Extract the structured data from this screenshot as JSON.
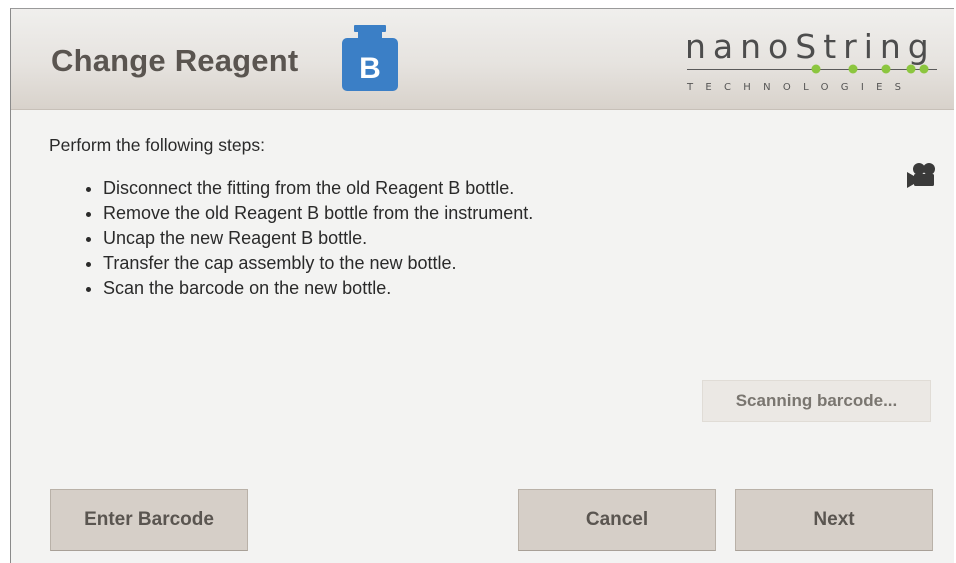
{
  "header": {
    "title": "Change Reagent",
    "bottle_letter": "B",
    "bottle_color": "#3b7fc6",
    "logo_word": "nanoString",
    "logo_sub": "TECHNOLOGIES",
    "logo_dot_color": "#8cc63f"
  },
  "instructions": {
    "intro": "Perform the following steps:",
    "steps": [
      "Disconnect the fitting from the old Reagent B bottle.",
      "Remove the old Reagent B bottle from the instrument.",
      "Uncap the new Reagent B bottle.",
      "Transfer the cap assembly to the new bottle.",
      "Scan the barcode on the new bottle."
    ]
  },
  "video_icon": "video-camera-icon",
  "status": {
    "scanning_label": "Scanning barcode..."
  },
  "buttons": {
    "enter_barcode": "Enter Barcode",
    "cancel": "Cancel",
    "next": "Next"
  }
}
